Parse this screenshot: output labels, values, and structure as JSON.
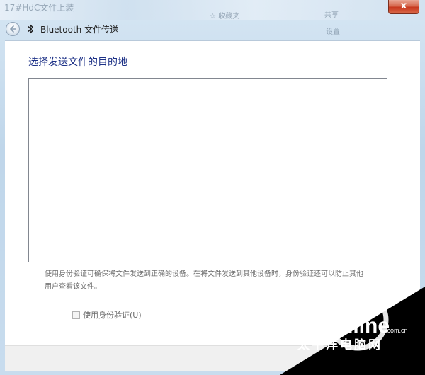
{
  "background": {
    "left_snippet": "17#HdC文件上装",
    "right_snippet_1": "共享",
    "right_snippet_2": "设置",
    "right_snippet_3": "☆ 收藏夹"
  },
  "window": {
    "title": "Bluetooth 文件传送",
    "close_label": "x"
  },
  "main": {
    "heading": "选择发送文件的目的地",
    "devices": [],
    "description": "使用身份验证可确保将文件发送到正确的设备。在将文件发送到其他设备时，身份验证还可以防止其他用户查看该文件。",
    "auth_checkbox": {
      "label": "使用身份验证(U)",
      "checked": false
    }
  },
  "watermark": {
    "logo": "PConline",
    "domain": ".com.cn",
    "tagline": "太平洋电脑网"
  },
  "colors": {
    "heading": "#1e3287",
    "panel_bg": "#ffffff",
    "footer_bg": "#f0f0f0",
    "frame": "#c9dcec"
  }
}
